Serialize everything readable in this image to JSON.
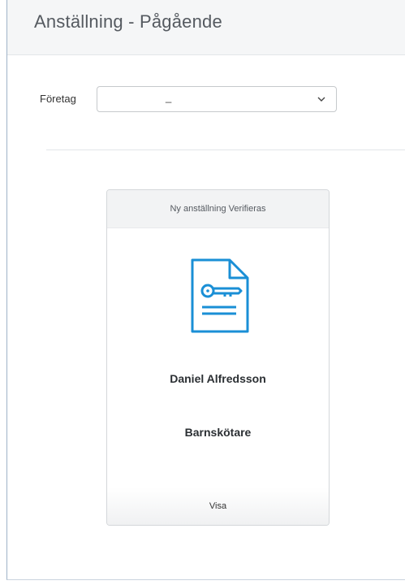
{
  "header": {
    "title": "Anställning - Pågående"
  },
  "filter": {
    "company_label": "Företag",
    "company_value": "_"
  },
  "card": {
    "status": "Ny anställning Verifieras",
    "icon": "document-key-icon",
    "name": "Daniel Alfredsson",
    "role": "Barnskötare",
    "action_label": "Visa"
  },
  "colors": {
    "icon_blue": "#1a8fd6"
  }
}
